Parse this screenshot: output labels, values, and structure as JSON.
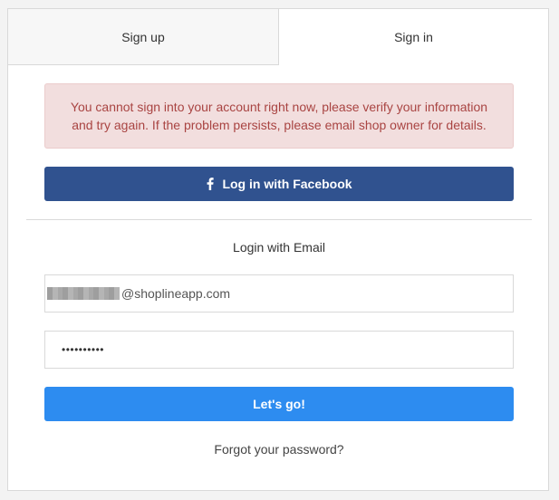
{
  "tabs": {
    "signup_label": "Sign up",
    "signin_label": "Sign in",
    "active": "signin"
  },
  "alert": {
    "message": "You cannot sign into your account right now, please verify your information and try again. If the problem persists, please email shop owner for details."
  },
  "facebook": {
    "label": "Log in with Facebook",
    "icon": "facebook-icon"
  },
  "email_section": {
    "heading": "Login with Email"
  },
  "form": {
    "email_domain": "@shoplineapp.com",
    "password_masked": "••••••••••"
  },
  "buttons": {
    "submit_label": "Let's go!",
    "forgot_label": "Forgot your password?"
  },
  "colors": {
    "facebook": "#30528f",
    "primary": "#2d8cf0",
    "alert_bg": "#f2dede",
    "alert_text": "#a94442"
  }
}
